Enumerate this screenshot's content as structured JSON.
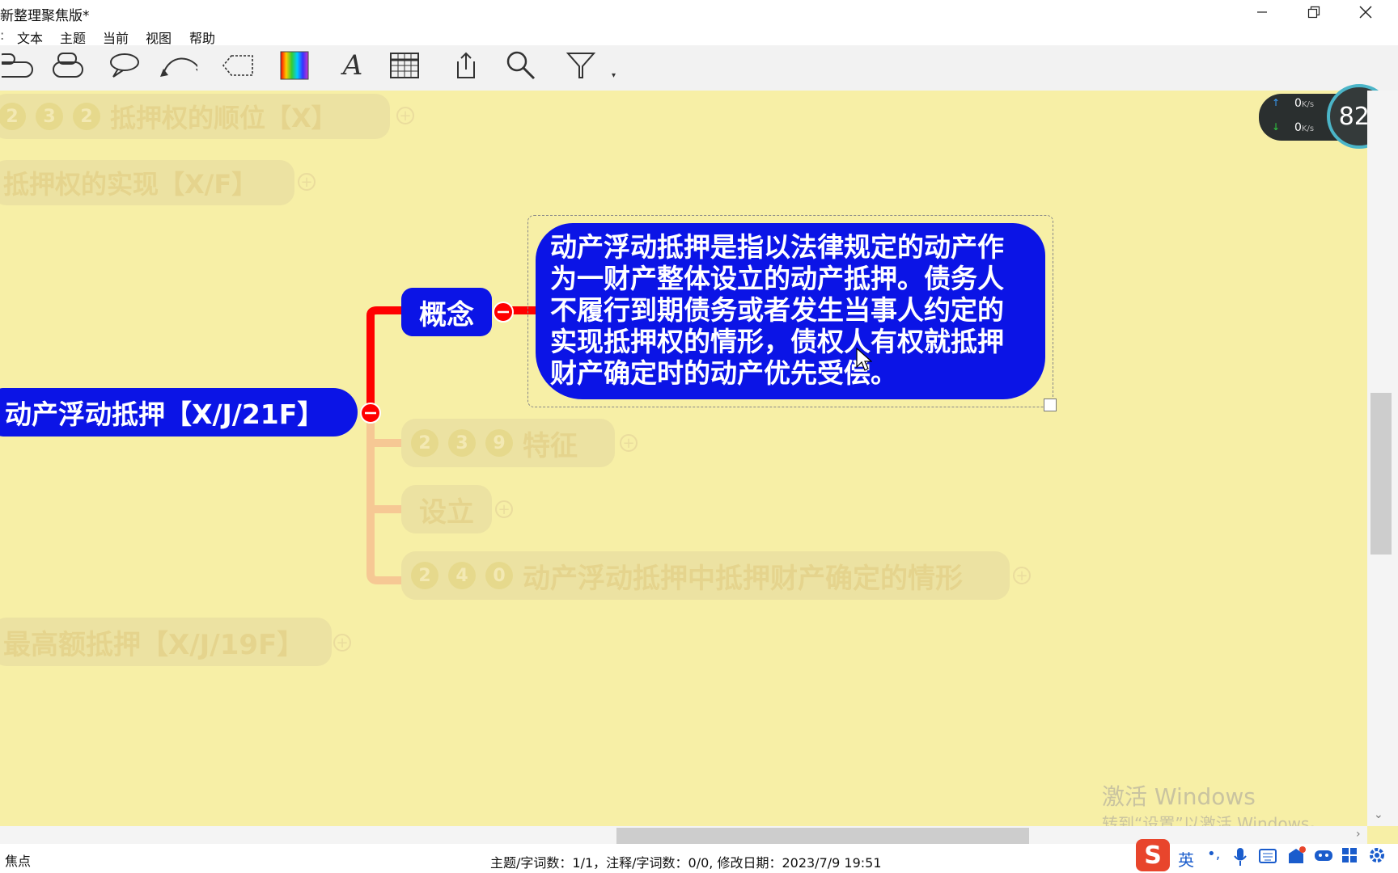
{
  "window": {
    "title": "新整理聚焦版*"
  },
  "menu": {
    "items": [
      "文本",
      "主题",
      "当前",
      "视图",
      "帮助"
    ]
  },
  "mindmap": {
    "faded_nodes": [
      {
        "id": "order",
        "badges": [
          "2",
          "3",
          "2"
        ],
        "label": "抵押权的顺位【X】"
      },
      {
        "id": "realize",
        "badges": [],
        "label": "抵押权的实现【X/F】"
      },
      {
        "id": "feature",
        "badges": [
          "2",
          "3",
          "9"
        ],
        "label": "特征"
      },
      {
        "id": "setup",
        "badges": [],
        "label": "设立"
      },
      {
        "id": "determine",
        "badges": [
          "2",
          "4",
          "0"
        ],
        "label": "动产浮动抵押中抵押财产确定的情形"
      },
      {
        "id": "maximum",
        "badges": [],
        "label": "最高额抵押【X/J/19F】"
      }
    ],
    "main_node": "动产浮动抵押【X/J/21F】",
    "concept_node": "概念",
    "note_lines": [
      "动产浮动抵押是指以法律规定的动产作",
      "为一财产整体设立的动产抵押。债务人",
      "不履行到期债务或者发生当事人约定的",
      "实现抵押权的情形，债权人有权就抵押",
      "财产确定时的动产优先受偿。"
    ]
  },
  "net_widget": {
    "upload": "0",
    "download": "0",
    "unit": "K/s",
    "percent": "82",
    "percent_sign": "%"
  },
  "watermark": {
    "line1": "激活 Windows",
    "line2": "转到“设置”以激活 Windows。"
  },
  "status": {
    "left": "焦点",
    "center": "主题/字词数：1/1，注释/字词数：0/0, 修改日期：2023/7/9 19:51"
  },
  "ime": {
    "lang": "英",
    "punct": "•,"
  },
  "colors": {
    "canvas": "#f7efa6",
    "node_blue": "#0b14e6",
    "connector_red": "#ff0000"
  }
}
